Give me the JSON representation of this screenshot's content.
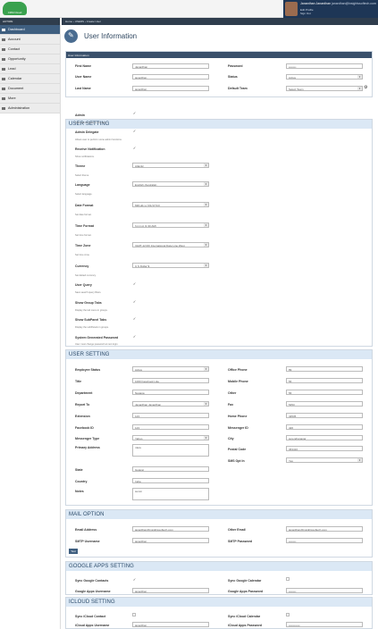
{
  "app": {
    "logo_text": "CRM Cloud",
    "profile_name": "Janardhan Janardhan",
    "profile_email": "janardhan@insightssoftech.com",
    "profile_menu": [
      "Edit Profile",
      "Sign Out"
    ]
  },
  "sidebar": {
    "header": "ACTION",
    "items": [
      {
        "label": "Dashboard",
        "active": true
      },
      {
        "label": "Account"
      },
      {
        "label": "Contact"
      },
      {
        "label": "Opportunity"
      },
      {
        "label": "Lead"
      },
      {
        "label": "Calendar"
      },
      {
        "label": "Document"
      },
      {
        "label": "More"
      },
      {
        "label": "Administration"
      }
    ]
  },
  "breadcrumb": [
    "Home",
    "USERS",
    "Create User"
  ],
  "page": {
    "title": "User Information"
  },
  "user_information": {
    "header": "User Information",
    "first_name": {
      "label": "First Name",
      "value": "Janardhan"
    },
    "user_name": {
      "label": "User Name",
      "value": "janardhan"
    },
    "last_name": {
      "label": "Last Name",
      "value": "janardhan"
    },
    "password": {
      "label": "Password",
      "value": "••••••••"
    },
    "status": {
      "label": "Status",
      "value": "Active"
    },
    "default_team": {
      "label": "Default Team",
      "value": "Select Team"
    }
  },
  "user_setting1": {
    "header": "USER SETTING",
    "admin": {
      "label": "Admin",
      "hint": "Grant admin rights to this user."
    },
    "admin_delegate": {
      "label": "Admin Delegate",
      "hint": "Allows user to perform some admin functions."
    },
    "receive_notification": {
      "label": "Receive Notification",
      "hint": "Show notifications."
    },
    "theme": {
      "label": "Theme",
      "value": "Atlantic",
      "hint": "Select theme."
    },
    "language": {
      "label": "Language",
      "value": "English (Australia)",
      "hint": "Select language."
    },
    "date_format": {
      "label": "Date Format",
      "value": "MM-dd-yy (01/17/14)",
      "hint": "Set date format."
    },
    "time_format": {
      "label": "Time Format",
      "value": "h:mm A (1:30 AM)",
      "hint": "Set time format."
    },
    "time_zone": {
      "label": "Time Zone",
      "value": "(GMT-12:00) International Date Line West",
      "hint": "Set time zone."
    },
    "currency": {
      "label": "Currency",
      "value": "U.S Dollar $",
      "hint": "Set default currency."
    },
    "user_query": {
      "label": "User Query",
      "hint": "Save search query filters."
    },
    "show_group_tabs": {
      "label": "Show Group Tabs",
      "hint": "Display the tab menu in groups."
    },
    "show_subpanel_tabs": {
      "label": "Show SubPanel Tabs",
      "hint": "Display the subPanels in groups."
    },
    "system_generated_password": {
      "label": "System Generated Password",
      "hint": "User must change password at next login."
    }
  },
  "user_setting2": {
    "header": "USER SETTING",
    "employee_status": {
      "label": "Employee Status",
      "value": "Active"
    },
    "title": {
      "label": "Title",
      "value": "1000 Facebook Like"
    },
    "department": {
      "label": "Department",
      "value": "Nagaga"
    },
    "reports_to": {
      "label": "Report To",
      "value": "Janardhan Janardhan"
    },
    "extension": {
      "label": "Extension",
      "value": "123"
    },
    "facebook_id": {
      "label": "Facebook ID",
      "value": "123"
    },
    "messenger_type": {
      "label": "Messenger Type",
      "value": "Yahoo"
    },
    "primary_address": {
      "label": "Primary Address",
      "value": "mksv"
    },
    "state": {
      "label": "State",
      "value": "Gujarat"
    },
    "country": {
      "label": "Country",
      "value": "India"
    },
    "notes": {
      "label": "Notes",
      "value": "summ"
    },
    "office_phone": {
      "label": "Office Phone",
      "value": "89"
    },
    "mobile_phone": {
      "label": "Mobile Phone",
      "value": "56"
    },
    "other": {
      "label": "Other",
      "value": "56"
    },
    "fax": {
      "label": "Fax",
      "value": "5453"
    },
    "home_phone": {
      "label": "Home Phone",
      "value": "43535"
    },
    "messenger_id": {
      "label": "Messenger ID",
      "value": "426"
    },
    "city": {
      "label": "City",
      "value": "surendranagar"
    },
    "postal_code": {
      "label": "Postal Code",
      "value": "363410"
    },
    "sms_opt_in": {
      "label": "SMS Opt In",
      "value": "Yes"
    }
  },
  "mail_option": {
    "header": "MAIL OPTION",
    "email_address": {
      "label": "Email Address",
      "value": "janardhan@insightssoftech.com"
    },
    "smtp_username": {
      "label": "SMTP Username",
      "value": "janardhan"
    },
    "other_email": {
      "label": "Other Email",
      "value": "janardhan@insightssoftech.com"
    },
    "smtp_password": {
      "label": "SMTP Password",
      "value": "••••••••"
    },
    "test_button": "Test"
  },
  "google_apps": {
    "header": "GOOGLE APPS SETTING",
    "sync_contacts": {
      "label": "Sync Google Contacts"
    },
    "sync_calendar": {
      "label": "Sync Google Calendar"
    },
    "username": {
      "label": "Google Apps Username",
      "value": "janardhan"
    },
    "password": {
      "label": "Google Apps Password",
      "value": "••••••••"
    }
  },
  "icloud": {
    "header": "ICLOUD SETTING",
    "sync_contact": {
      "label": "Sync iCloud Contact"
    },
    "sync_calendar": {
      "label": "Sync iCloud Calendar"
    },
    "username": {
      "label": "iCloud Apps Username",
      "value": "janardhan"
    },
    "password": {
      "label": "iCloud Apps Password",
      "value": "••••••••••••"
    }
  }
}
